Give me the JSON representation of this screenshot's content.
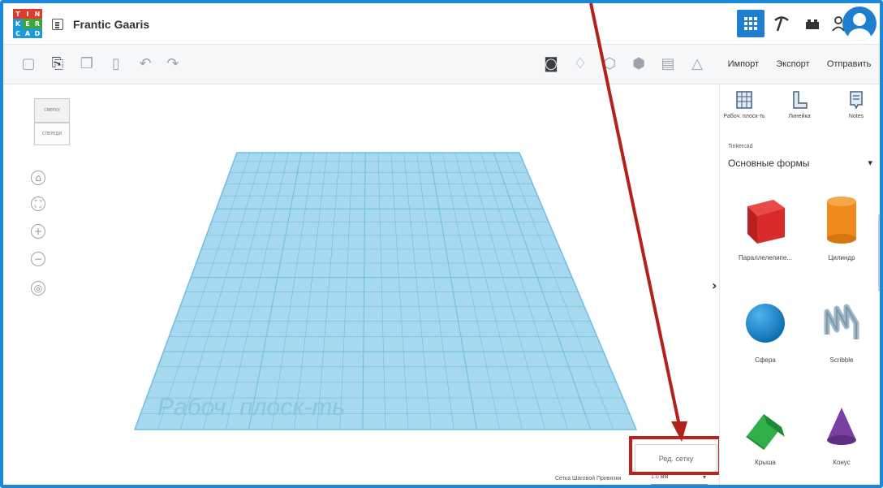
{
  "app": {
    "logo_letters": [
      "T",
      "I",
      "N",
      "K",
      "E",
      "R",
      "C",
      "A",
      "D"
    ]
  },
  "title": {
    "doc_name": "Frantic Gaaris"
  },
  "toolbar": {
    "import_label": "Импорт",
    "export_label": "Экспорт",
    "send_label": "Отправить"
  },
  "viewcube": {
    "top_label": "СВЕРХУ",
    "front_label": "СПЕРЕДИ"
  },
  "workplane": {
    "label": "Рабоч. плоск-ть"
  },
  "bottom": {
    "edit_grid_label": "Ред. сетку",
    "snap_label": "Сетка Шаговой Привязки",
    "snap_value": "1.0 мм"
  },
  "panel": {
    "tools": [
      {
        "label": "Рабоч. плоск-ть",
        "icon": "workplane-icon"
      },
      {
        "label": "Линейка",
        "icon": "ruler-icon"
      },
      {
        "label": "Notes",
        "icon": "notes-icon"
      }
    ],
    "category_small": "Tinkercad",
    "category": "Основные формы",
    "shapes": [
      {
        "label": "Параллелепипе...",
        "color": "#d92b2b"
      },
      {
        "label": "Цилиндр",
        "color": "#ef8a1b"
      },
      {
        "label": "Сфера",
        "color": "#1a8ad6"
      },
      {
        "label": "Scribble",
        "color": "#9fb8c8"
      },
      {
        "label": "Крыша",
        "color": "#2fb04a"
      },
      {
        "label": "Конус",
        "color": "#7b3fa2"
      }
    ]
  },
  "colors": {
    "accent": "#1e7fd0",
    "highlight": "#c0201a",
    "grid": "#a6d9ef"
  }
}
